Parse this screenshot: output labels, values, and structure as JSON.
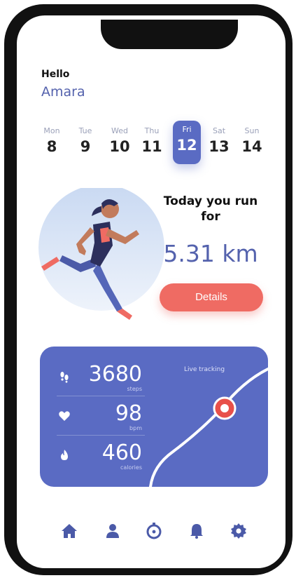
{
  "greeting": {
    "hello": "Hello",
    "name": "Amara"
  },
  "days": [
    {
      "name": "Mon",
      "date": "8"
    },
    {
      "name": "Tue",
      "date": "9"
    },
    {
      "name": "Wed",
      "date": "10"
    },
    {
      "name": "Thu",
      "date": "11"
    },
    {
      "name": "Fri",
      "date": "12",
      "active": true
    },
    {
      "name": "Sat",
      "date": "13"
    },
    {
      "name": "Sun",
      "date": "14"
    }
  ],
  "run": {
    "title": "Today you run for",
    "distance": "5.31 km",
    "button": "Details"
  },
  "stats": {
    "steps": {
      "value": "3680",
      "unit": "steps"
    },
    "heart": {
      "value": "98",
      "unit": "bpm"
    },
    "calories": {
      "value": "460",
      "unit": "calories"
    },
    "live_label": "Live tracking"
  },
  "nav": [
    "home-icon",
    "profile-icon",
    "timer-icon",
    "bell-icon",
    "settings-icon"
  ],
  "colors": {
    "accent": "#5a6bc3",
    "accent_text": "#5462ad",
    "button": "#ef6b63",
    "marker": "#e8504a"
  }
}
